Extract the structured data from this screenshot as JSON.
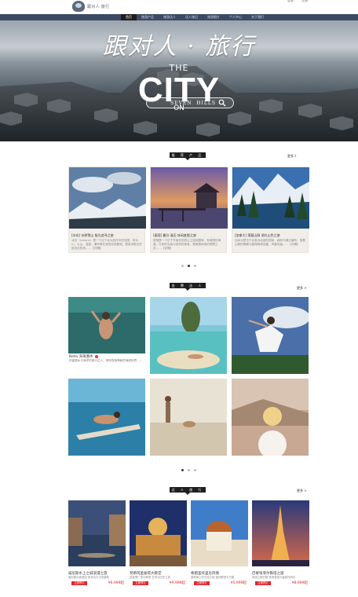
{
  "brand": {
    "name": "跟对人·旅行"
  },
  "toplinks": [
    "登录",
    "注册"
  ],
  "nav": [
    "首页",
    "旅游产品",
    "旅游达人",
    "达人旅记",
    "旅游图片",
    "个人中心",
    "关于我们"
  ],
  "hero": {
    "title": "跟对人 · 旅行",
    "the": "THE",
    "city": "CITY",
    "on": "ON",
    "search_placeholder": "SEVEN  HILLS"
  },
  "products": {
    "heading": "推 荐 产 品",
    "more": "更多 》",
    "items": [
      {
        "title": "[冰岛] 冰原雪山 极光追寻之旅",
        "desc": "冰岛（Iceland）是一个位于北大西洋中的岛国，有冰川、火山、温泉、瀑布等壮观的自然景观，是追寻极光的绝佳目的地……【详情】"
      },
      {
        "title": "[泰国] 曼谷·清迈 休闲度假之旅",
        "desc": "泰国是一个位于东南亚的君主立宪制国家，有美丽的海滩、古老的寺庙与独特的美食，是度假休闲的理想之选……【详情】"
      },
      {
        "title": "[加拿大] 落基山脉 湖光山色之旅",
        "desc": "加拿大是位于北美洲北部的国家，森林与湖泊遍布，落基山脉的雪峰与碧湖相映成趣，风景如画……【详情】"
      }
    ],
    "dots": [
      false,
      true,
      false
    ]
  },
  "people": {
    "heading": "金 牌 达 人",
    "more": "更多 >",
    "caption_name": "Bella 深海潜水",
    "caption_desc": "热爱潜水与海洋的旅行达人，带你探索神秘的海底世界……",
    "dots": [
      true,
      false,
      false
    ]
  },
  "travel": {
    "heading": "达 人 旅 行",
    "more": "更多 >",
    "items": [
      {
        "name": "威尼斯水上之城浪漫之旅",
        "desc": "威尼斯水城漫游·贡多拉与古老建筑",
        "btn": "立即预订",
        "price": "¥6,999起"
      },
      {
        "name": "梵蒂冈圣彼得大教堂",
        "desc": "圣彼得广场与教堂 艺术与历史之旅",
        "btn": "立即预订",
        "price": "¥9,999起"
      },
      {
        "name": "希腊圣托里尼风情",
        "desc": "爱琴海上的白色小镇 蓝顶教堂与日落",
        "btn": "立即预订",
        "price": "¥5,999起"
      },
      {
        "name": "巴黎埃菲尔铁塔之旅",
        "desc": "浪漫之都巴黎 铁塔夜景与塞纳河风光",
        "btn": "立即预订",
        "price": "¥8,999起"
      }
    ]
  }
}
